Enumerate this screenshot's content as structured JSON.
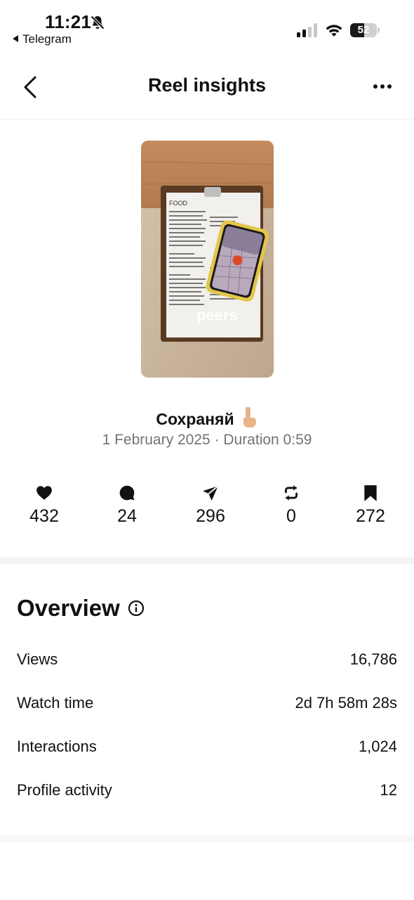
{
  "status_bar": {
    "time": "11:21",
    "back_app": "Telegram",
    "battery_percent": 52,
    "battery_label": "52",
    "signal_bars": 2
  },
  "header": {
    "title": "Reel insights"
  },
  "reel": {
    "title": "Сохраняй",
    "date": "1 February 2025",
    "duration": "Duration 0:59",
    "thumbnail_text": {
      "menu_heading": "FOOD",
      "logo": "peers"
    }
  },
  "stats": [
    {
      "icon": "heart-icon",
      "value": "432"
    },
    {
      "icon": "comment-icon",
      "value": "24"
    },
    {
      "icon": "share-icon",
      "value": "296"
    },
    {
      "icon": "repost-icon",
      "value": "0"
    },
    {
      "icon": "bookmark-icon",
      "value": "272"
    }
  ],
  "overview": {
    "title": "Overview",
    "rows": [
      {
        "label": "Views",
        "value": "16,786"
      },
      {
        "label": "Watch time",
        "value": "2d 7h 58m 28s"
      },
      {
        "label": "Interactions",
        "value": "1,024"
      },
      {
        "label": "Profile activity",
        "value": "12"
      }
    ]
  },
  "colors": {
    "text_primary": "#111111",
    "text_secondary": "#737373",
    "divider": "#f5f5f5"
  }
}
